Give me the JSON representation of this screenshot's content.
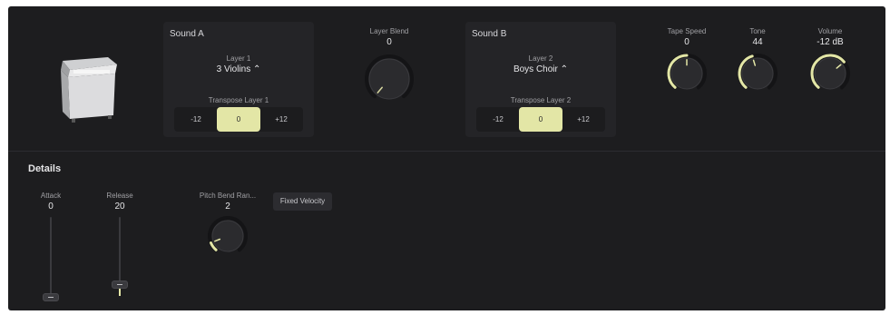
{
  "colors": {
    "background": "#1d1d1f",
    "panel": "#242427",
    "accent": "#e3e6a6",
    "knob_track": "#141416"
  },
  "sound_a": {
    "title": "Sound A",
    "layer_label": "Layer 1",
    "layer_value": "3 Violins ⌃",
    "transpose_label": "Transpose Layer 1",
    "transpose_options": [
      "-12",
      "0",
      "+12"
    ],
    "transpose_selected": "0"
  },
  "layer_blend": {
    "label": "Layer Blend",
    "value": "0",
    "level": 0.0
  },
  "sound_b": {
    "title": "Sound B",
    "layer_label": "Layer 2",
    "layer_value": "Boys Choir ⌃",
    "transpose_label": "Transpose Layer 2",
    "transpose_options": [
      "-12",
      "0",
      "+12"
    ],
    "transpose_selected": "0"
  },
  "tape_speed": {
    "label": "Tape Speed",
    "value": "0",
    "level": 0.5
  },
  "tone": {
    "label": "Tone",
    "value": "44",
    "level": 0.44
  },
  "volume": {
    "label": "Volume",
    "value": "-12 dB",
    "level": 0.68
  },
  "details": {
    "title": "Details",
    "attack": {
      "label": "Attack",
      "value": "0",
      "level": 0.0
    },
    "release": {
      "label": "Release",
      "value": "20",
      "level": 0.2
    },
    "pitch_bend": {
      "label": "Pitch Bend Ran...",
      "value": "2",
      "level": 0.1
    },
    "fixed_velocity_label": "Fixed Velocity"
  }
}
